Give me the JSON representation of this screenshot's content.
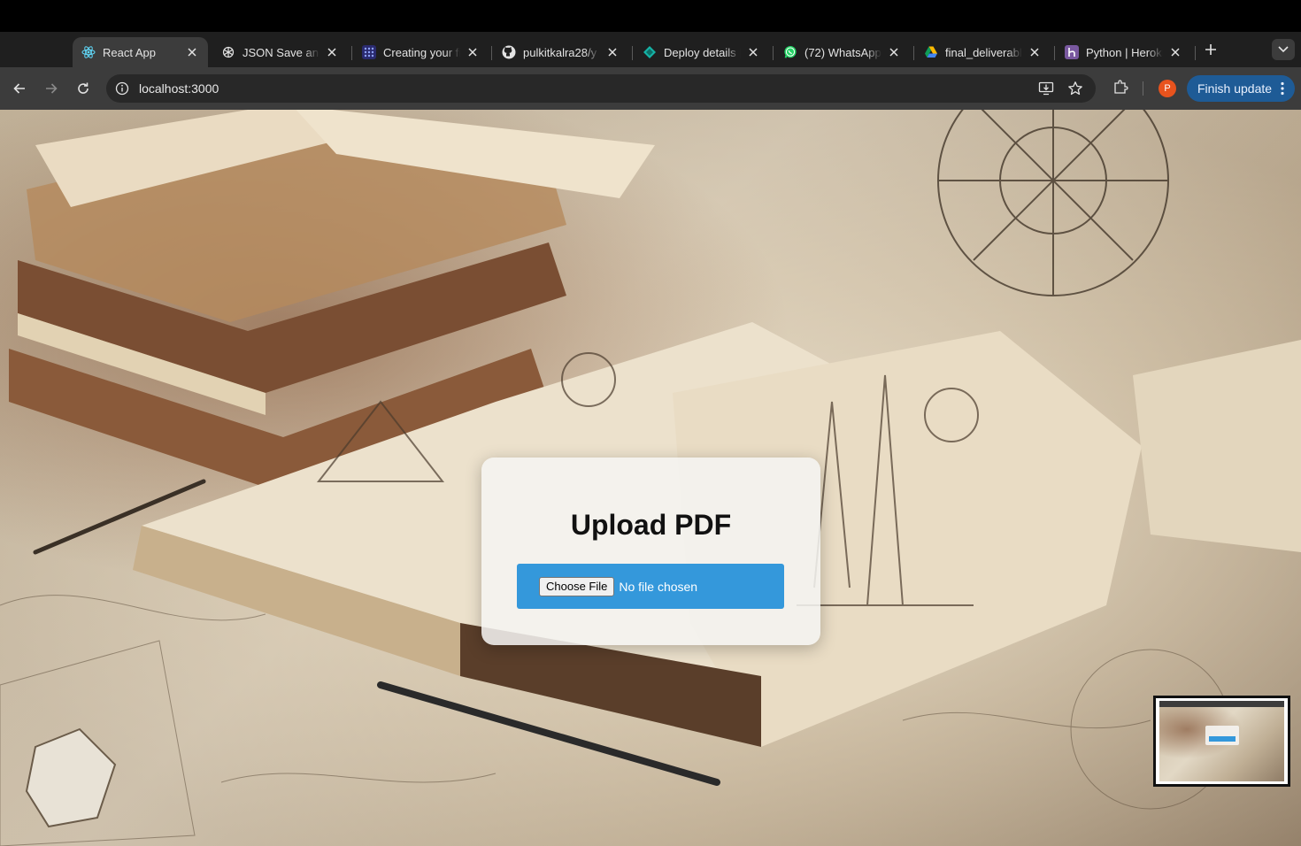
{
  "browser": {
    "tabs": [
      {
        "title": "React App",
        "icon": "react-icon",
        "active": true
      },
      {
        "title": "JSON Save and",
        "icon": "openai-icon",
        "active": false
      },
      {
        "title": "Creating your fi",
        "icon": "grid-dots-icon",
        "active": false
      },
      {
        "title": "pulkitkalra28/y",
        "icon": "github-icon",
        "active": false
      },
      {
        "title": "Deploy details |",
        "icon": "deploy-diamond-icon",
        "active": false
      },
      {
        "title": "(72) WhatsApp",
        "icon": "whatsapp-icon",
        "active": false
      },
      {
        "title": "final_deliverabl",
        "icon": "google-drive-icon",
        "active": false
      },
      {
        "title": "Python | Heroku",
        "icon": "heroku-icon",
        "active": false
      }
    ],
    "address": "localhost:3000",
    "profile_initial": "P",
    "finish_update_label": "Finish update",
    "accent": "#1e5b96"
  },
  "page": {
    "heading": "Upload PDF",
    "choose_file_label": "Choose File",
    "file_status": "No file chosen",
    "upload_zone_color": "#3498db"
  }
}
